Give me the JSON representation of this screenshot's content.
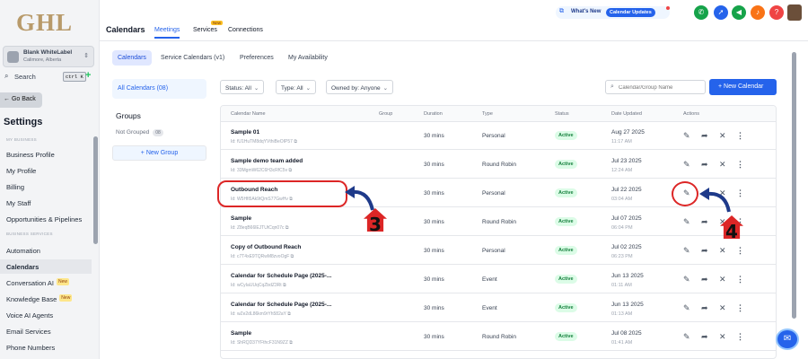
{
  "sidebar": {
    "logo": "GHL",
    "account_name": "Blank WhiteLabel",
    "account_location": "Calimore, Alberta",
    "search_label": "Search",
    "search_shortcut": "ctrl K",
    "back_label": "Go Back",
    "title": "Settings",
    "section_my_business": "MY BUSINESS",
    "section_business_services": "BUSINESS SERVICES",
    "items_my_business": [
      "Business Profile",
      "My Profile",
      "Billing",
      "My Staff",
      "Opportunities & Pipelines"
    ],
    "items_services": [
      "Automation",
      "Calendars",
      "Conversation AI",
      "Knowledge Base",
      "Voice AI Agents",
      "Email Services",
      "Phone Numbers"
    ],
    "new_badge": "New",
    "active_item": "Calendars"
  },
  "header": {
    "title": "Calendars",
    "tabs": [
      "Meetings",
      "Services",
      "Connections"
    ],
    "active_tab": "Meetings",
    "services_badge": "New",
    "whats_new": "What's New",
    "calendar_updates": "Calendar Updates",
    "icon_colors": {
      "phone": "#16a34a",
      "rocket": "#2563eb",
      "megaphone": "#16a34a",
      "bell": "#f97316",
      "help": "#ef4444"
    }
  },
  "subtabs": [
    "Calendars",
    "Service Calendars (v1)",
    "Preferences",
    "My Availability"
  ],
  "left_panel": {
    "all_calendars": "All Calendars (08)",
    "groups_heading": "Groups",
    "not_grouped": "Not Grouped",
    "not_grouped_count": "08",
    "new_group": "+ New Group"
  },
  "filters": {
    "status": "Status: All",
    "type": "Type: All",
    "owner": "Owned by: Anyone",
    "search_placeholder": "Calendar/Group Name",
    "new_calendar": "+ New Calendar"
  },
  "table": {
    "columns": [
      "Calendar Name",
      "Group",
      "Duration",
      "Type",
      "Status",
      "Date Updated",
      "Actions"
    ],
    "rows": [
      {
        "name": "Sample 01",
        "id": "Id: fU1HuTM8dqYVthiBeOIP57 ⧉",
        "duration": "30 mins",
        "type": "Personal",
        "status": "Active",
        "date": "Aug 27 2025",
        "time": "11:17 AM"
      },
      {
        "name": "Sample demo team added",
        "id": "Id: 33MgmW62C6H3cRfC5v ⧉",
        "duration": "30 mins",
        "type": "Round Robin",
        "status": "Active",
        "date": "Jul 23 2025",
        "time": "12:24 AM"
      },
      {
        "name": "Outbound Reach",
        "id": "Id: W5Hfi5Ak9tQmS77GwHv ⧉",
        "duration": "30 mins",
        "type": "Personal",
        "status": "Active",
        "date": "Jul 22 2025",
        "time": "03:04 AM"
      },
      {
        "name": "Sample",
        "id": "Id: Z8eqB66lEJTUtCqn07c ⧉",
        "duration": "30 mins",
        "type": "Round Robin",
        "status": "Active",
        "date": "Jul 07 2025",
        "time": "06:04 PM"
      },
      {
        "name": "Copy of Outbound Reach",
        "id": "Id: c7T4xE9TQRwM8zvoOgF ⧉",
        "duration": "30 mins",
        "type": "Personal",
        "status": "Active",
        "date": "Jul 02 2025",
        "time": "06:23 PM"
      },
      {
        "name": "Calendar for Schedule Page (2025-...",
        "id": "Id: wCyIaUUqCqZbdZ3Rt ⧉",
        "duration": "30 mins",
        "type": "Event",
        "status": "Active",
        "date": "Jun 13 2025",
        "time": "01:11 AM"
      },
      {
        "name": "Calendar for Schedule Page (2025-...",
        "id": "Id: wZe2dL86km9rYh582aY ⧉",
        "duration": "30 mins",
        "type": "Event",
        "status": "Active",
        "date": "Jun 13 2025",
        "time": "01:13 AM"
      },
      {
        "name": "Sample",
        "id": "Id: ShRQD37YFthcF31N9ZZ ⧉",
        "duration": "30 mins",
        "type": "Round Robin",
        "status": "Active",
        "date": "Jul 08 2025",
        "time": "01:41 AM"
      }
    ]
  },
  "annotations": {
    "step_a": "3",
    "step_b": "4",
    "color": "#dc2626",
    "arrow_color": "#1e3a8a"
  }
}
